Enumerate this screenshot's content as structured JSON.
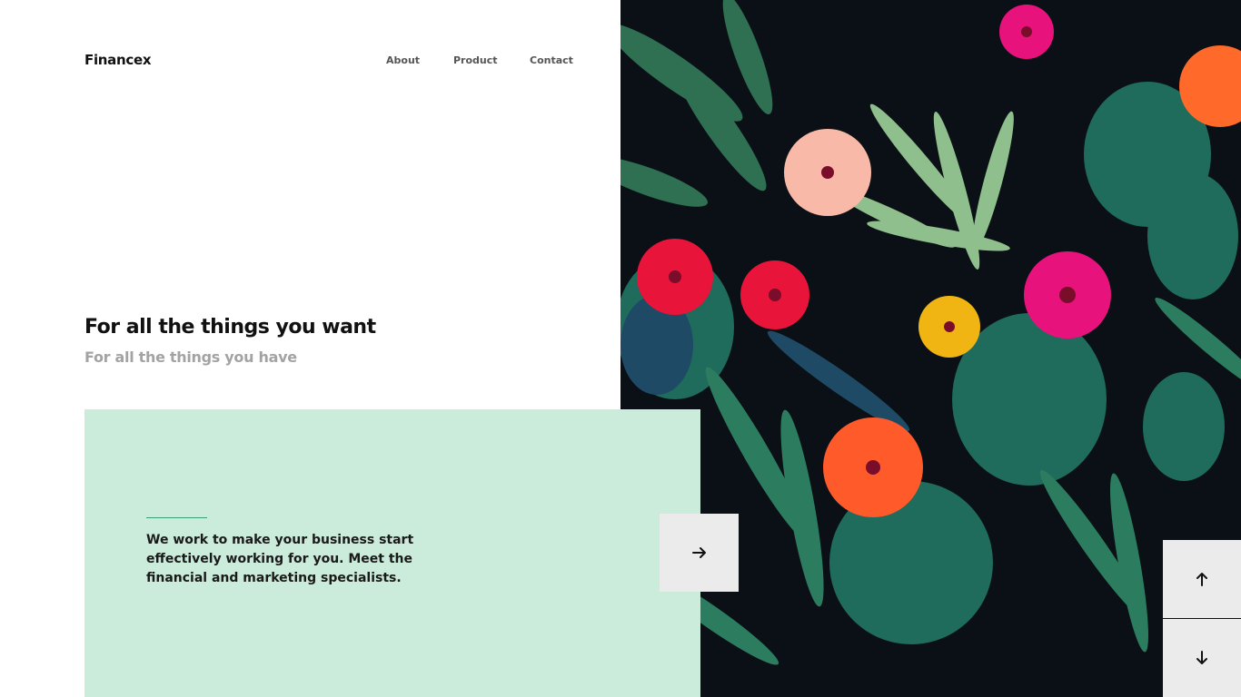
{
  "brand": {
    "name": "Financex"
  },
  "nav": {
    "items": [
      {
        "label": "About"
      },
      {
        "label": "Product"
      },
      {
        "label": "Contact"
      }
    ]
  },
  "hero": {
    "headline": "For all the things you want",
    "subheadline": "For all the things you have",
    "image_icon": "tropical-floral-pattern"
  },
  "promo": {
    "text": "We work to make your business start effectively working for you. Meet the financial and marketing specialists.",
    "next_icon": "arrow-right-icon"
  },
  "slider_controls": {
    "up_icon": "arrow-up-icon",
    "down_icon": "arrow-down-icon"
  },
  "colors": {
    "background": "#ffffff",
    "card": "#cbebdb",
    "accent_line": "#3c9b77",
    "button_bg": "#ebebeb",
    "image_bg": "#0a1015",
    "text_primary": "#111111",
    "text_secondary": "#a3a3a3"
  }
}
